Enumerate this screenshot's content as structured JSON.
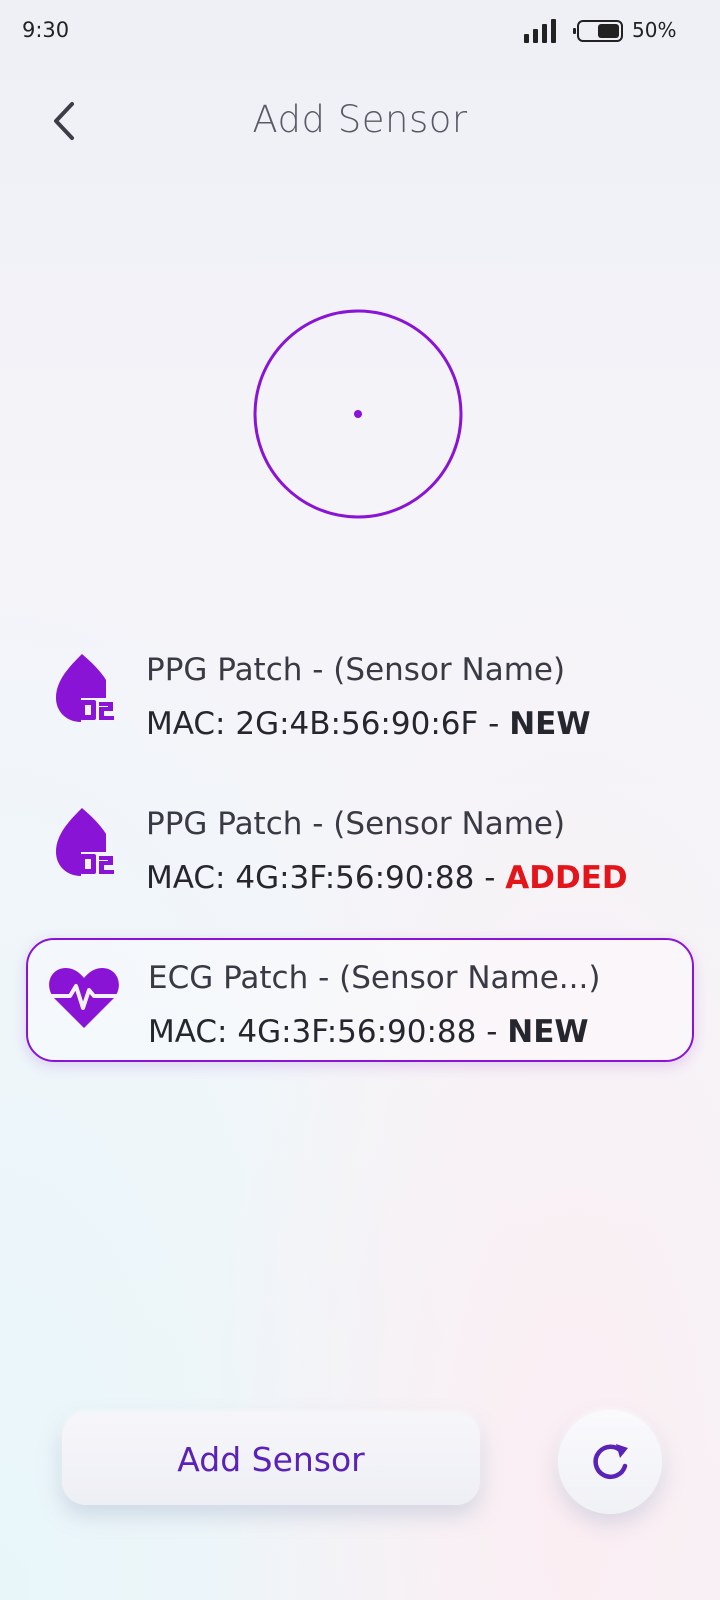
{
  "status_bar": {
    "time": "9:30",
    "battery": "50%"
  },
  "header": {
    "title": "Add Sensor",
    "back_icon": "chevron-left-icon"
  },
  "scanner": {
    "icon": "radar-icon",
    "color": "#8a14d6"
  },
  "sensors": [
    {
      "name": "PPG Patch - (Sensor Name)",
      "mac_prefix": "MAC: 2G:4B:56:90:6F - ",
      "status": "NEW",
      "icon": "oxygen-drop-icon",
      "selected": false
    },
    {
      "name": "PPG Patch - (Sensor Name)",
      "mac_prefix": "MAC: 4G:3F:56:90:88 - ",
      "status": "ADDED",
      "icon": "oxygen-drop-icon",
      "selected": false
    },
    {
      "name": "ECG Patch - (Sensor Name...)",
      "mac_prefix": "MAC: 4G:3F:56:90:88 - ",
      "status": "NEW",
      "icon": "heart-pulse-icon",
      "selected": true
    }
  ],
  "footer": {
    "add_button_label": "Add Sensor",
    "refresh_icon": "refresh-icon"
  },
  "colors": {
    "accent": "#8a14d6",
    "added": "#e4141b",
    "button_text": "#5b22b8"
  }
}
